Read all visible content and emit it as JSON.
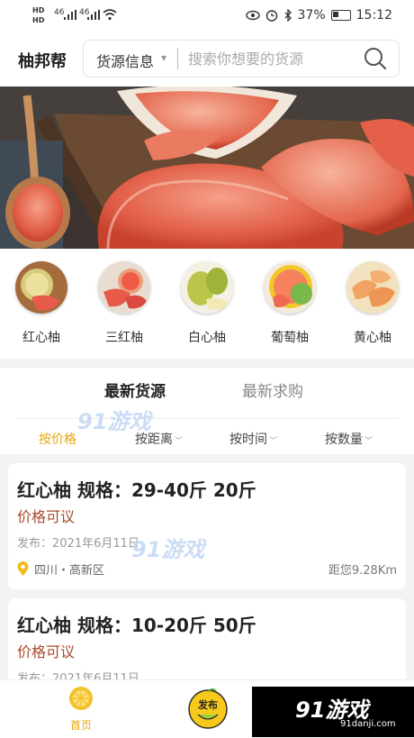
{
  "status_bar": {
    "left_top": "HD",
    "left_bottom": "HD",
    "network": "46",
    "network2": "46",
    "battery": "37%",
    "time": "15:12"
  },
  "header": {
    "app_title": "柚邦帮",
    "search_category": "货源信息",
    "search_placeholder": "搜索你想要的货源"
  },
  "banner": {
    "slides": 2,
    "active_slide": 1
  },
  "categories": [
    {
      "label": "红心柚",
      "icon": "red-pomelo"
    },
    {
      "label": "三红柚",
      "icon": "triple-red-pomelo"
    },
    {
      "label": "白心柚",
      "icon": "white-pomelo"
    },
    {
      "label": "葡萄柚",
      "icon": "grapefruit"
    },
    {
      "label": "黄心柚",
      "icon": "yellow-pomelo"
    }
  ],
  "tabs": {
    "latest_supply": "最新货源",
    "latest_demand": "最新求购"
  },
  "sort": {
    "price": "按价格",
    "distance": "按距离",
    "time": "按时间",
    "quantity": "按数量"
  },
  "listings": [
    {
      "title": "红心柚  规格：29-40斤  20斤",
      "price": "价格可议",
      "date": "发布：2021年6月11日",
      "location": "四川・高新区",
      "distance": "距您9.28Km"
    },
    {
      "title": "红心柚  规格：10-20斤  50斤",
      "price": "价格可议",
      "date": "发布：2021年6月11日"
    }
  ],
  "bottom_nav": {
    "home_label": "首页",
    "publish_label": "发布"
  },
  "watermark": {
    "text": "91游戏",
    "domain": "91danji.com"
  },
  "colors": {
    "accent": "#e9a60d",
    "price": "#a54a2a",
    "background": "#f3f3f3"
  }
}
